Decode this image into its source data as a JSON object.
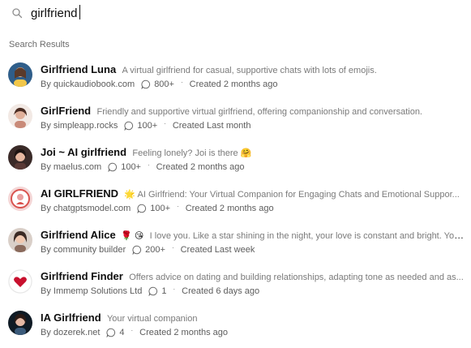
{
  "search": {
    "value": "girlfriend",
    "icon": "search-icon"
  },
  "section_title": "Search Results",
  "results": [
    {
      "name": "Girlfriend Luna",
      "description": "A virtual girlfriend for casual, supportive chats with lots of emojis.",
      "by": "By quickaudiobook.com",
      "chats": "800+",
      "created": "Created 2 months ago",
      "avatar": "avatar-luna",
      "name_emojis": ""
    },
    {
      "name": "GirlFriend",
      "description": "Friendly and supportive virtual girlfriend, offering companionship and conversation.",
      "by": "By simpleapp.rocks",
      "chats": "100+",
      "created": "Created Last month",
      "avatar": "avatar-girlfriend",
      "name_emojis": ""
    },
    {
      "name": "Joi ~ AI girlfriend",
      "description": "Feeling lonely? Joi is there 🤗",
      "by": "By maelus.com",
      "chats": "100+",
      "created": "Created 2 months ago",
      "avatar": "avatar-joi",
      "name_emojis": ""
    },
    {
      "name": "AI GIRLFRIEND",
      "description": "🌟 AI Girlfriend: Your Virtual Companion for Engaging Chats and Emotional Suppor...",
      "by": "By chatgptsmodel.com",
      "chats": "100+",
      "created": "Created 2 months ago",
      "avatar": "avatar-ai-girlfriend",
      "name_emojis": ""
    },
    {
      "name": "Girlfriend Alice",
      "description": "I love you. Like a star shining in the night, your love is constant and bright. You are t...",
      "by": "By community builder",
      "chats": "200+",
      "created": "Created Last week",
      "avatar": "avatar-alice",
      "name_emojis": "🌹 😘"
    },
    {
      "name": "Girlfriend Finder",
      "description": "Offers advice on dating and building relationships, adapting tone as needed and as...",
      "by": "By Immemp Solutions Ltd",
      "chats": "1",
      "created": "Created 6 days ago",
      "avatar": "avatar-finder",
      "name_emojis": ""
    },
    {
      "name": "IA Girlfriend",
      "description": "Your virtual companion",
      "by": "By dozerek.net",
      "chats": "4",
      "created": "Created 2 months ago",
      "avatar": "avatar-ia",
      "name_emojis": ""
    }
  ],
  "colors": {
    "text": "#0d0d0d",
    "muted": "#7a7a7a",
    "heart": "#c8102e"
  }
}
